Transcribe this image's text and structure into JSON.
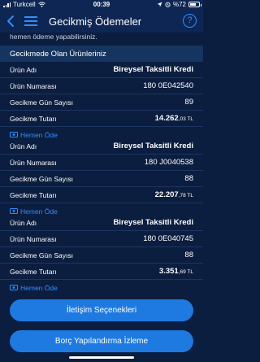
{
  "status_bar": {
    "carrier": "Turkcell",
    "time": "00:39",
    "battery": "%72",
    "battery_level": 0.72
  },
  "nav": {
    "title": "Gecikmiş Ödemeler",
    "help_icon": "?"
  },
  "intro_text": "hemen ödeme yapabilirsiniz.",
  "section_title": "Gecikmede Olan Ürünleriniz",
  "labels": {
    "product_name": "Ürün Adı",
    "product_number": "Ürün Numarası",
    "delay_days": "Gecikme Gün Sayısı",
    "delay_amount": "Gecikme Tutarı",
    "pay_now": "Hemen Öde"
  },
  "products": [
    {
      "name": "Bireysel Taksitli Kredi",
      "number": "180 0E042540",
      "days": "89",
      "amount_main": "14.262",
      "amount_decimal": ",03 TL"
    },
    {
      "name": "Bireysel Taksitli Kredi",
      "number": "180 J0040538",
      "days": "88",
      "amount_main": "22.207",
      "amount_decimal": ",78 TL"
    },
    {
      "name": "Bireysel Taksitli Kredi",
      "number": "180 0E040745",
      "days": "88",
      "amount_main": "3.351",
      "amount_decimal": ",69 TL"
    }
  ],
  "buttons": {
    "contact": "İletişim Seçenekleri",
    "restructure": "Borç Yapılandırma İzleme"
  },
  "colors": {
    "background": "#0b1e3f",
    "header": "#0e2654",
    "section": "#15345f",
    "accent": "#2f8fff",
    "button": "#1e7ae0"
  }
}
